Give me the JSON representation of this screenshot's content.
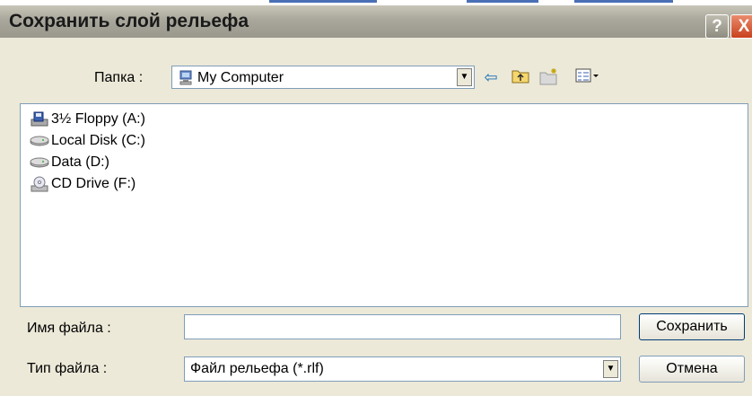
{
  "dialog": {
    "title": "Сохранить слой рельефа",
    "help_glyph": "?",
    "close_glyph": "X"
  },
  "folder": {
    "label": "Папка :",
    "value": "My Computer",
    "toolbar": [
      "back-icon",
      "up-folder-icon",
      "new-folder-icon",
      "view-menu-icon"
    ]
  },
  "files": [
    {
      "name": "3½ Floppy (A:)",
      "icon": "floppy-drive-icon"
    },
    {
      "name": "Local Disk (C:)",
      "icon": "hard-disk-icon"
    },
    {
      "name": "Data (D:)",
      "icon": "hard-disk-icon"
    },
    {
      "name": "CD Drive (F:)",
      "icon": "cd-drive-icon"
    }
  ],
  "filename": {
    "label": "Имя файла :",
    "value": ""
  },
  "filetype": {
    "label": "Тип файла :",
    "value": "Файл рельефа (*.rlf)"
  },
  "buttons": {
    "save": "Сохранить",
    "cancel": "Отмена"
  },
  "colors": {
    "accent": "#003c74",
    "titlebar": "#a9a79b",
    "close": "#c9421d",
    "background": "#ece9d8"
  }
}
